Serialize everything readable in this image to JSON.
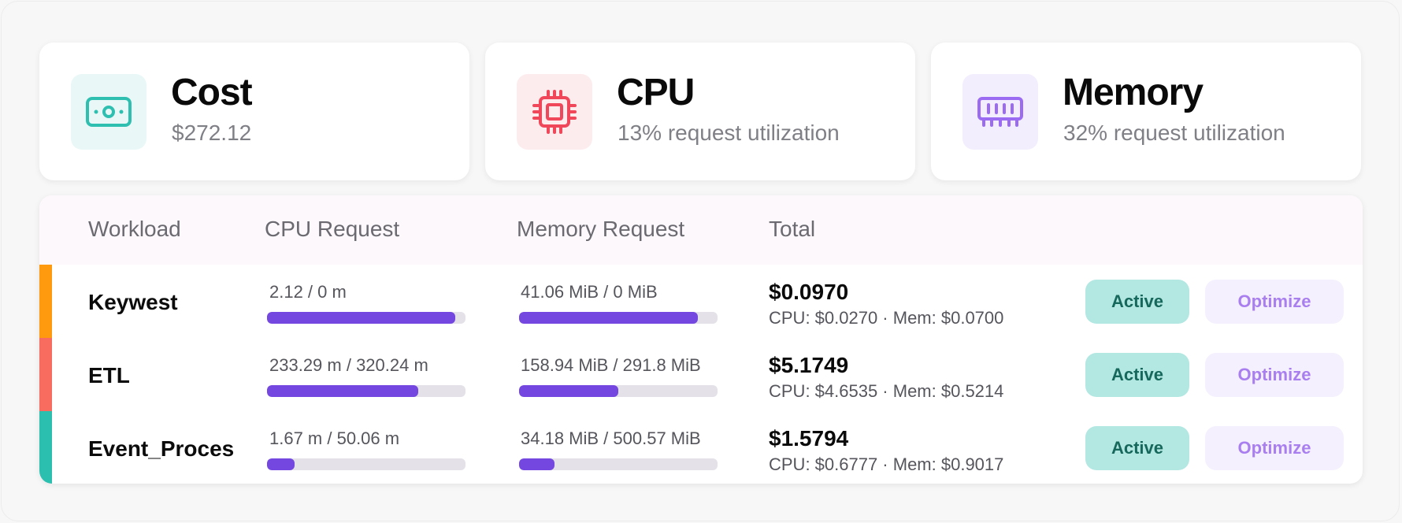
{
  "cards": {
    "cost": {
      "title": "Cost",
      "subtitle": "$272.12",
      "icon": "money-bill-icon",
      "color": "#2fbfb0",
      "bg": "#e9f7f7"
    },
    "cpu": {
      "title": "CPU",
      "subtitle": "13% request utilization",
      "icon": "cpu-chip-icon",
      "color": "#f0475a",
      "bg": "#fdecee"
    },
    "memory": {
      "title": "Memory",
      "subtitle": "32% request utilization",
      "icon": "memory-module-icon",
      "color": "#9b6cf2",
      "bg": "#f3eefd"
    }
  },
  "table": {
    "headers": {
      "workload": "Workload",
      "cpu": "CPU Request",
      "memory": "Memory Request",
      "total": "Total"
    },
    "rows": [
      {
        "name": "Keywest",
        "stripe_color": "#ff9a0f",
        "cpu_label": "2.12 / 0 m",
        "cpu_fill": 0.95,
        "mem_label": "41.06 MiB / 0 MiB",
        "mem_fill": 0.9,
        "total": "$0.0970",
        "breakdown": "CPU: $0.0270 · Mem: $0.0700",
        "status": "Active",
        "action": "Optimize"
      },
      {
        "name": "ETL",
        "stripe_color": "#f86c60",
        "cpu_label": "233.29 m / 320.24 m",
        "cpu_fill": 0.76,
        "mem_label": "158.94 MiB / 291.8 MiB",
        "mem_fill": 0.5,
        "total": "$5.1749",
        "breakdown": "CPU: $4.6535 · Mem: $0.5214",
        "status": "Active",
        "action": "Optimize"
      },
      {
        "name": "Event_Proces",
        "stripe_color": "#2bbfb0",
        "cpu_label": "1.67 m / 50.06 m",
        "cpu_fill": 0.14,
        "mem_label": "34.18 MiB / 500.57 MiB",
        "mem_fill": 0.18,
        "total": "$1.5794",
        "breakdown": "CPU: $0.6777 · Mem: $0.9017",
        "status": "Active",
        "action": "Optimize"
      }
    ]
  }
}
